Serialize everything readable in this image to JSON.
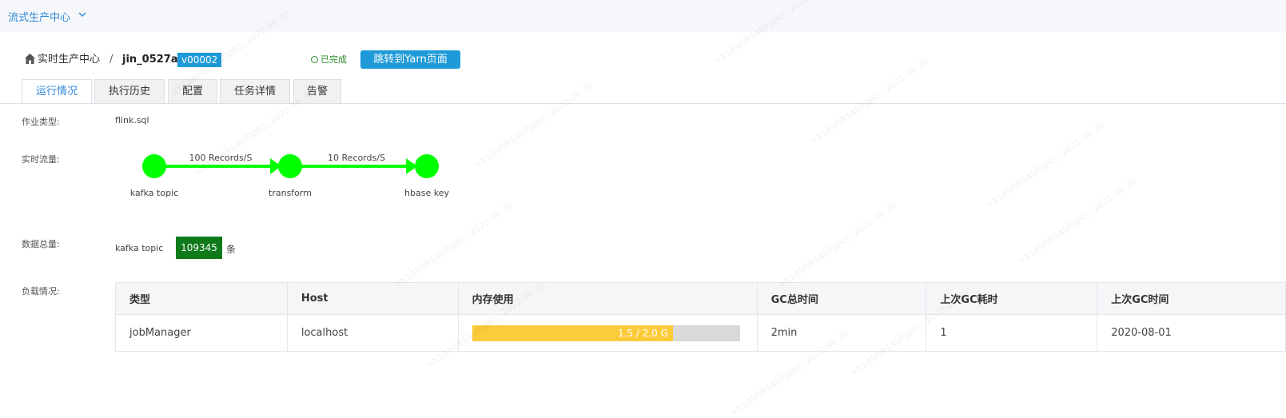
{
  "topbar": {
    "app_title": "流式生产中心"
  },
  "breadcrumb": {
    "root": "实时生产中心",
    "separator": "/",
    "job_name": "jin_0527a",
    "version": "v00002"
  },
  "status": {
    "text": "已完成",
    "color": "#2a8a2a"
  },
  "yarn_button": {
    "label": "跳转到Yarn页面"
  },
  "tabs": [
    {
      "label": "运行情况",
      "active": true
    },
    {
      "label": "执行历史",
      "active": false
    },
    {
      "label": "配置",
      "active": false
    },
    {
      "label": "任务详情",
      "active": false
    },
    {
      "label": "告警",
      "active": false
    }
  ],
  "fields": {
    "job_type_label": "作业类型:",
    "job_type_value": "flink.sql",
    "realtime_flow_label": "实时流量:",
    "data_total_label": "数据总量:",
    "load_label": "负载情况:"
  },
  "flow": {
    "nodes": [
      "kafka topic",
      "transform",
      "hbase key"
    ],
    "edges": [
      "100 Records/S",
      "10 Records/S"
    ],
    "color": "#00ff00"
  },
  "data_total": {
    "source": "kafka topic",
    "count": "109345",
    "unit": "条"
  },
  "load_table": {
    "headers": [
      "类型",
      "Host",
      "内存使用",
      "GC总时间",
      "上次GC耗时",
      "上次GC时间"
    ],
    "rows": [
      {
        "type": "jobManager",
        "host": "localhost",
        "memory_label": "1.5 / 2.0 G",
        "memory_fraction": 0.75,
        "gc_total": "2min",
        "last_gc_duration": "1",
        "last_gc_time": "2020-08-01"
      }
    ]
  },
  "watermark_text": "VX1AN6B1A0RJ0K1, 2022-06-30",
  "colors": {
    "accent": "#1e9ad8",
    "link": "#2f88d8",
    "count_badge": "#0e7a1a",
    "memory_fill": "#fccb3a"
  }
}
